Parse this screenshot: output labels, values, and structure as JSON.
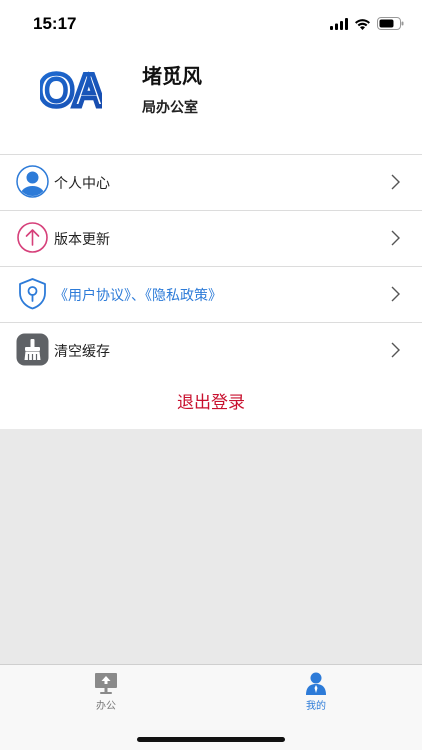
{
  "status_bar": {
    "time": "15:17"
  },
  "profile": {
    "logo_text": "OA",
    "name": "堵觅风",
    "department": "局办公室"
  },
  "menu": {
    "items": [
      {
        "label": "个人中心",
        "icon": "user-avatar-icon"
      },
      {
        "label": "版本更新",
        "icon": "upload-arrow-icon"
      },
      {
        "label": "《用户协议》、《隐私政策》",
        "icon": "shield-lock-icon"
      },
      {
        "label": "清空缓存",
        "icon": "broom-icon"
      }
    ]
  },
  "logout": {
    "label": "退出登录"
  },
  "tab_bar": {
    "tabs": [
      {
        "label": "办公",
        "icon": "office-desk-icon",
        "active": false
      },
      {
        "label": "我的",
        "icon": "user-person-icon",
        "active": true
      }
    ]
  },
  "colors": {
    "accent_blue": "#2d7bd8",
    "logout_red": "#c8102e",
    "version_pink": "#d6407a"
  }
}
